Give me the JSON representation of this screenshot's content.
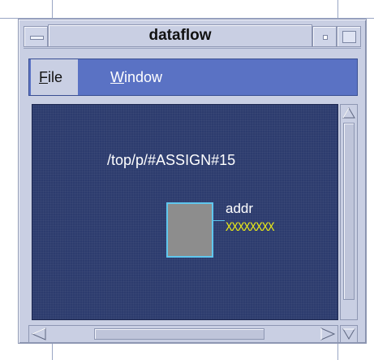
{
  "window": {
    "title": "dataflow"
  },
  "menubar": {
    "file": {
      "mnemonic": "F",
      "rest": "ile"
    },
    "window": {
      "mnemonic": "W",
      "rest": "indow"
    }
  },
  "canvas": {
    "path": "/top/p/#ASSIGN#15",
    "signal_name": "addr",
    "signal_value": "XXXXXXXX"
  },
  "icons": {
    "window_menu": "window-menu-icon",
    "minimize": "minimize-icon",
    "maximize": "maximize-icon",
    "scroll_up": "arrow-up-icon",
    "scroll_down": "arrow-down-icon",
    "scroll_left": "arrow-left-icon",
    "scroll_right": "arrow-right-icon"
  },
  "colors": {
    "canvas_bg": "#2d3c6e",
    "menubar_bg": "#5a72c4",
    "frame": "#c9cfe3",
    "signal_box": "#8d8d8d",
    "signal_outline": "#60c7ee",
    "signal_value": "#e6e619"
  }
}
